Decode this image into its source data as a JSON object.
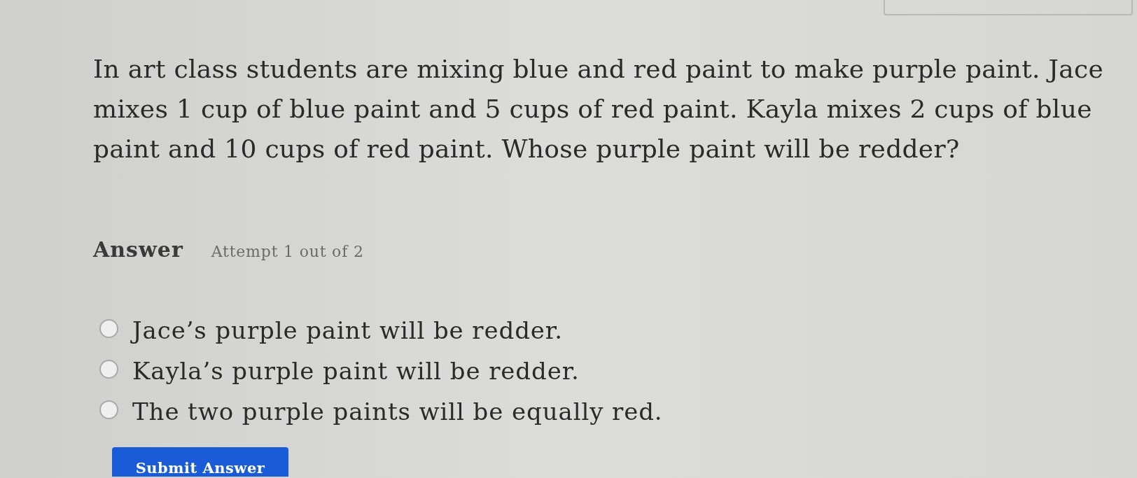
{
  "question": "In art class students are mixing blue and red paint to make purple paint. Jace mixes 1 cup of blue paint and 5 cups of red paint. Kayla mixes 2 cups of blue paint and 10 cups of red paint. Whose purple paint will be redder?",
  "answer": {
    "label": "Answer",
    "attempt": "Attempt 1 out of 2"
  },
  "options": [
    {
      "label": "Jace’s purple paint will be redder.",
      "selected": false
    },
    {
      "label": "Kayla’s purple paint will be redder.",
      "selected": false
    },
    {
      "label": "The two purple paints will be equally red.",
      "selected": false
    }
  ],
  "submit_button": "Submit Answer"
}
